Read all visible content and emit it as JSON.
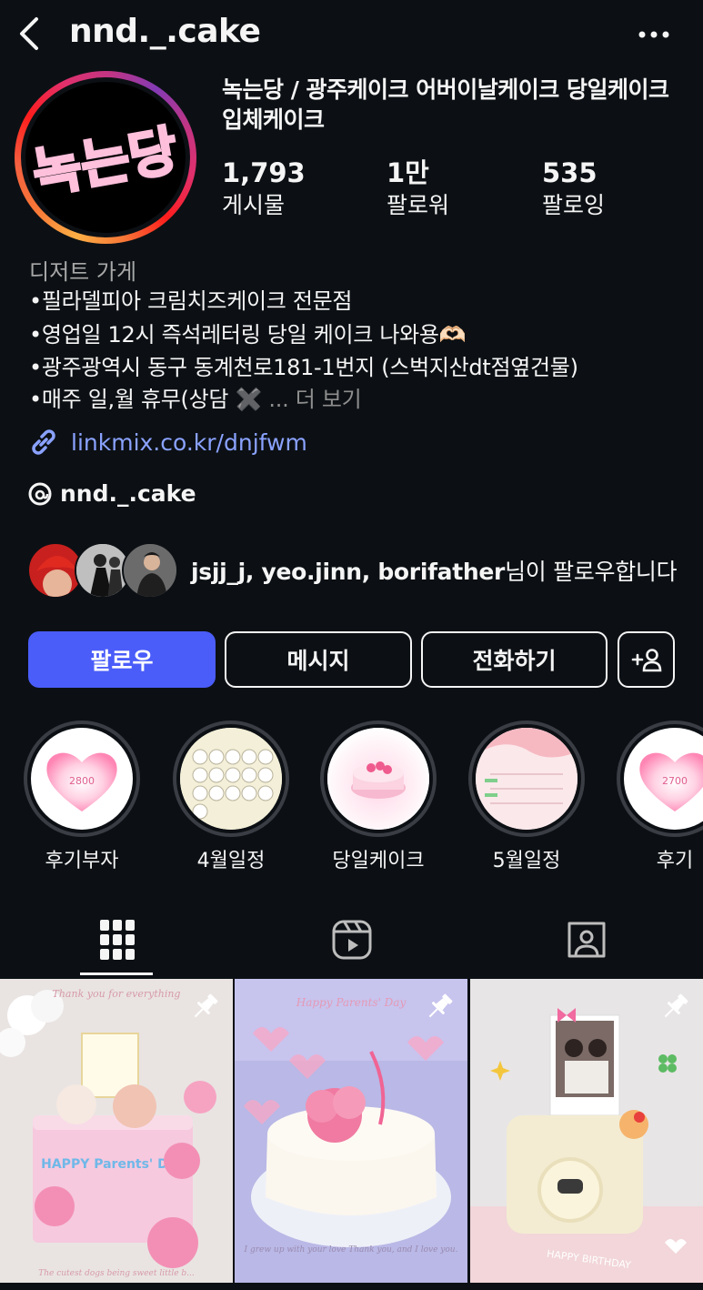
{
  "header": {
    "username": "nnd._.cake",
    "back_icon": "chevron-left-icon",
    "more_icon": "more-horizontal-icon"
  },
  "profile": {
    "avatar_text": "녹는당",
    "full_name": "녹는당 / 광주케이크 어버이날케이크 당일케이크 입체케이크",
    "stats": {
      "posts": {
        "value": "1,793",
        "label": "게시물"
      },
      "followers": {
        "value": "1만",
        "label": "팔로워"
      },
      "following": {
        "value": "535",
        "label": "팔로잉"
      }
    }
  },
  "bio": {
    "category": "디저트 가게",
    "lines": [
      "•필라델피아 크림치즈케이크 전문점",
      "•영업일 12시 즉석레터링 당일 케이크 나와용🫶🏻",
      "•광주광역시 동구 동계천로181-1번지 (스벅지산dt점옆건물)",
      "•매주 일,월 휴무(상담 ✖️"
    ],
    "more_label": "... 더 보기",
    "link": "linkmix.co.kr/dnjfwm",
    "threads_handle": "nnd._.cake"
  },
  "followed_by": {
    "names": "jsjj_j, yeo.jinn, borifather",
    "suffix": "님이 팔로우합니다"
  },
  "actions": {
    "follow": "팔로우",
    "message": "메시지",
    "call": "전화하기"
  },
  "highlights": [
    {
      "label": "후기부자",
      "text": "2800"
    },
    {
      "label": "4월일정",
      "text": ""
    },
    {
      "label": "당일케이크",
      "text": ""
    },
    {
      "label": "5월일정",
      "text": ""
    },
    {
      "label": "후기",
      "text": "2700"
    }
  ],
  "tabs": [
    "grid-icon",
    "reels-icon",
    "tagged-icon"
  ],
  "posts": [
    {
      "caption_top": "Thank you for everything",
      "cake_text": "HAPPY Parents' Day",
      "caption_bottom": "The cutest dogs being sweet little b..."
    },
    {
      "caption_top": "Happy Parents' Day",
      "caption_bottom": "I grew up with your love Thank you, and I love you."
    },
    {
      "cake_text": "HAPPY BIRTHDAY"
    }
  ],
  "colors": {
    "background": "#0c1014",
    "follow_button": "#4a5df9",
    "link": "#8aa2ff",
    "muted": "#a8a8a8"
  }
}
